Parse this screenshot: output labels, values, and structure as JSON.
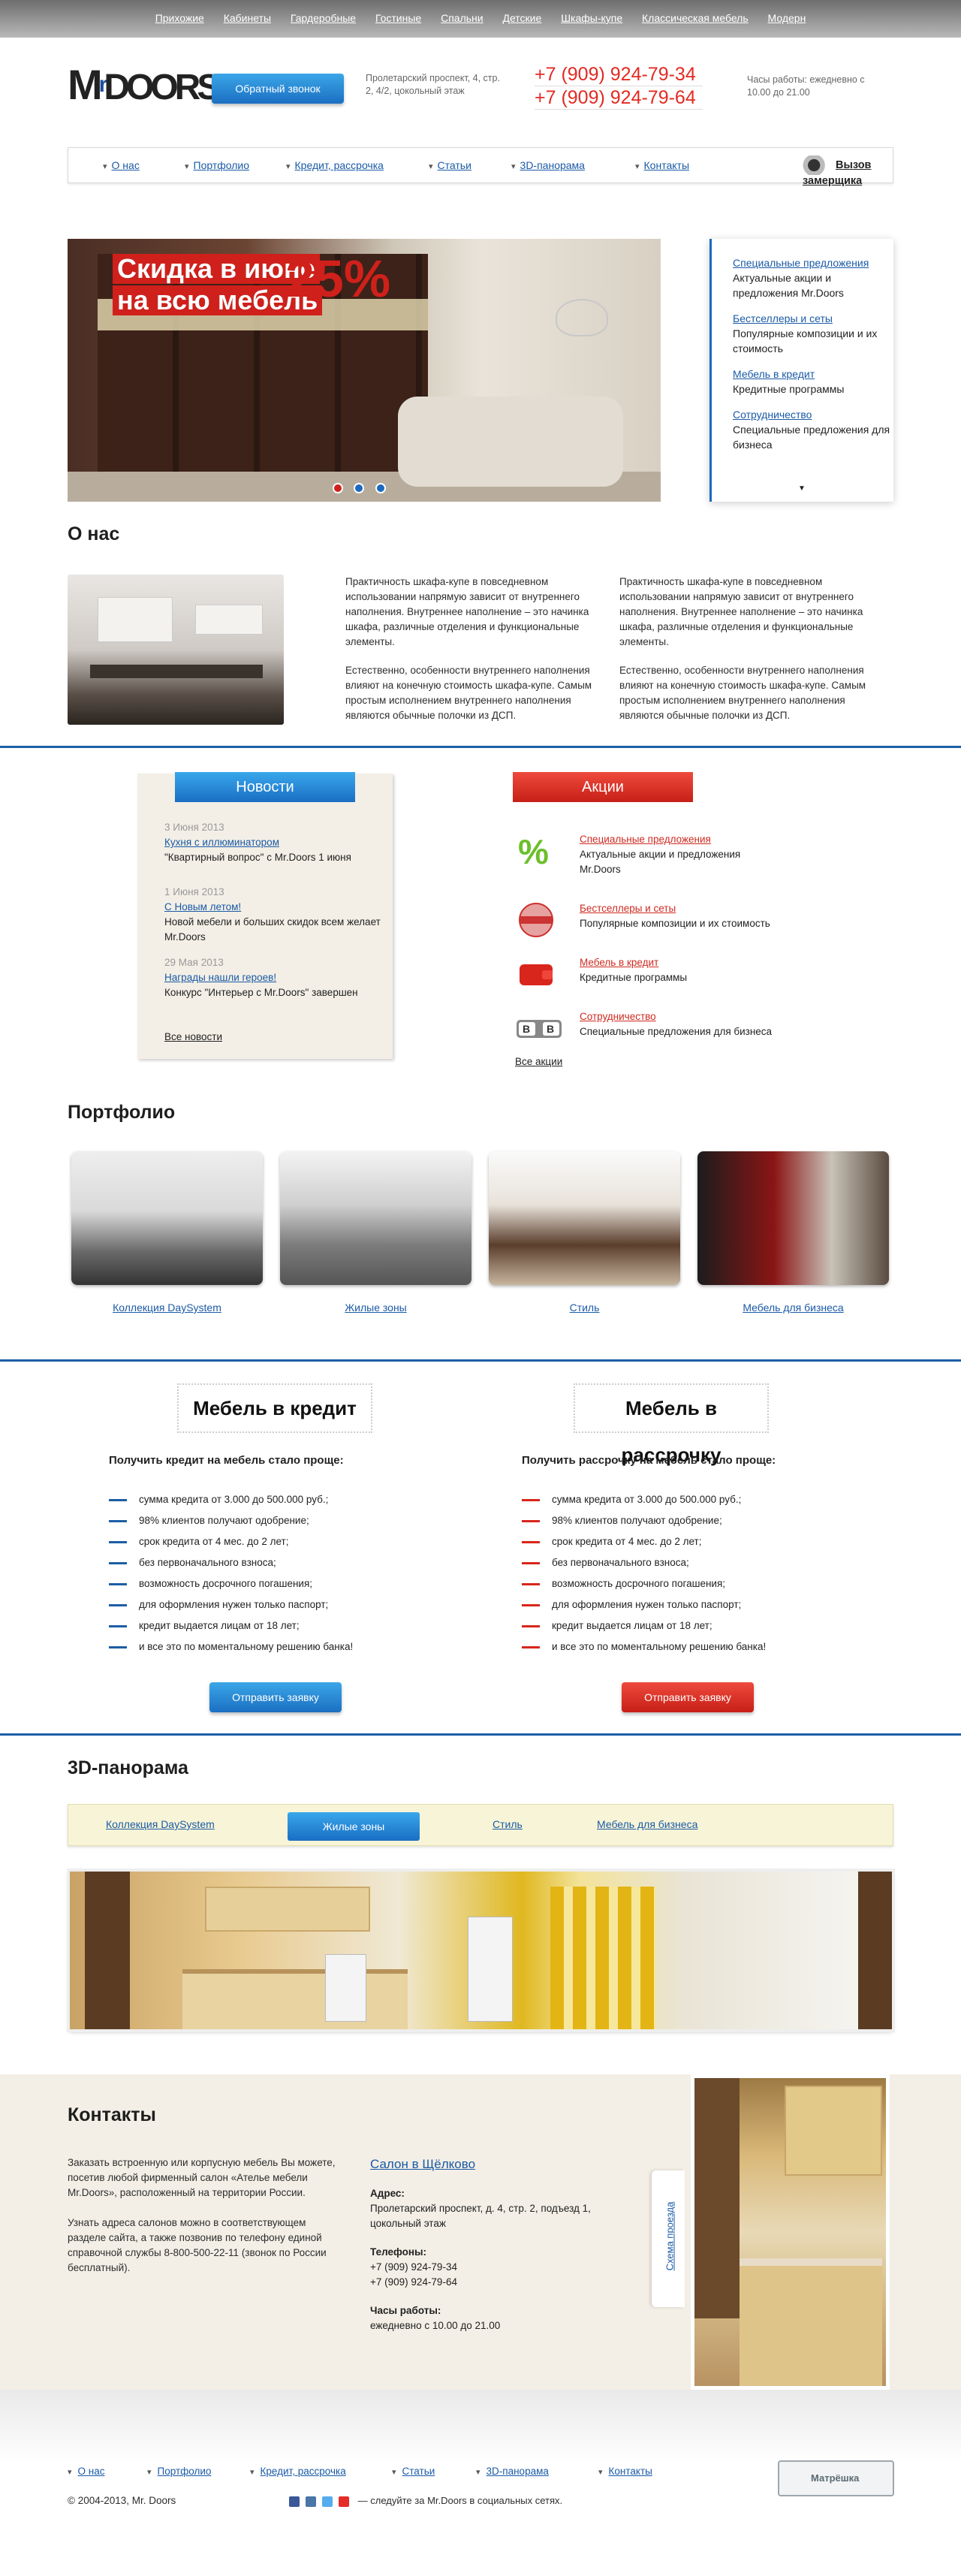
{
  "topnav": [
    "Прихожие",
    "Кабинеты",
    "Гардеробные",
    "Гостиные",
    "Спальни",
    "Детские",
    "Шкафы-купе",
    "Классическая мебель",
    "Модерн"
  ],
  "logo": {
    "text1": "M",
    "text2": "r",
    "text3": "DOORS",
    "alt": "Mr.Doors"
  },
  "header": {
    "callback_label": "Обратный звонок",
    "address": "Пролетарский проспект, 4, стр. 2, 4/2, цокольный этаж",
    "phone1": "+7 (909) 924-79-34",
    "phone2": "+7 (909) 924-79-64",
    "hours": "Часы работы: ежедневно с 10.00 до 21.00"
  },
  "mainnav": {
    "items": [
      "О нас",
      "Портфолио",
      "Кредит, рассрочка",
      "Статьи",
      "3D-панорама",
      "Контакты"
    ],
    "measure": "Вызов замерщика"
  },
  "banner": {
    "line1": "Скидка в июне",
    "line2": "на всю мебель",
    "percent": "25%",
    "dots": 3,
    "active_dot": 0,
    "colors": {
      "dot_active": "#d0201b",
      "dot": "#1c69c0"
    }
  },
  "sidebox": [
    {
      "link": "Специальные предложения",
      "text": "Актуальные акции и предложения Mr.Doors"
    },
    {
      "link": "Бестселлеры и сеты",
      "text": "Популярные композиции и их стоимость"
    },
    {
      "link": "Мебель в кредит",
      "text": "Кредитные программы"
    },
    {
      "link": "Сотрудничество",
      "text": "Специальные предложения для бизнеса"
    }
  ],
  "about": {
    "title": "О нас",
    "col1_p1": "Практичность шкафа-купе в повседневном использовании напрямую зависит от внутреннего наполнения. Внутреннее наполнение – это начинка шкафа, различные отделения и функциональные элементы.",
    "col1_p2": "Естественно, особенности внутреннего наполнения влияют на конечную стоимость шкафа-купе. Самым простым исполнением внутреннего наполнения являются обычные полочки из ДСП.",
    "col2_p1": "Практичность шкафа-купе в повседневном использовании напрямую зависит от внутреннего наполнения. Внутреннее наполнение – это начинка шкафа, различные отделения и функциональные элементы.",
    "col2_p2": "Естественно, особенности внутреннего наполнения влияют на конечную стоимость шкафа-купе. Самым простым исполнением внутреннего наполнения являются обычные полочки из ДСП."
  },
  "news": {
    "title": "Новости",
    "items": [
      {
        "date": "3 Июня 2013",
        "link": "Кухня с иллюминатором",
        "text": "\"Квартирный вопрос\" с Mr.Doors 1 июня"
      },
      {
        "date": "1 Июня 2013",
        "link": "С Новым летом!",
        "text": "Новой мебели и больших скидок всем желает Mr.Doors"
      },
      {
        "date": "29 Мая 2013",
        "link": "Награды нашли героев!",
        "text": "Конкурс \"Интерьер с Mr.Doors\" завершен"
      }
    ],
    "all": "Все новости"
  },
  "promos": {
    "title": "Акции",
    "items": [
      {
        "link": "Специальные предложения",
        "text": "Актуальные акции и предложения Mr.Doors",
        "icon": "percent-icon"
      },
      {
        "link": "Бестселлеры и сеты",
        "text": "Популярные композиции и их стоимость",
        "icon": "bestseller-stamp-icon"
      },
      {
        "link": "Мебель в кредит",
        "text": "Кредитные программы",
        "icon": "wallet-icon"
      },
      {
        "link": "Сотрудничество",
        "text": "Специальные предложения для бизнеса",
        "icon": "b2b-icon"
      }
    ],
    "all": "Все акции"
  },
  "portfolio": {
    "title": "Портфолио",
    "items": [
      "Коллекция DaySystem",
      "Жилые зоны",
      "Стиль",
      "Мебель для бизнеса"
    ]
  },
  "credit": {
    "left_title": "Мебель в кредит",
    "left_heading": "Получить кредит на мебель стало проще:",
    "right_title": "Мебель в рассрочку",
    "right_heading": "Получить рассрочку на мебель стало проще:",
    "items": [
      "сумма кредита от 3.000 до 500.000 руб.;",
      "98% клиентов получают одобрение;",
      "срок кредита от 4 мес. до 2 лет;",
      "без первоначального взноса;",
      "возможность досрочного погашения;",
      "для оформления нужен только паспорт;",
      "кредит выдается лицам от 18 лет;",
      "и все это по моментальному решению банка!"
    ],
    "button": "Отправить заявку"
  },
  "panorama": {
    "title": "3D-панорама",
    "tabs": [
      "Коллекция DaySystem",
      "Жилые зоны",
      "Стиль",
      "Мебель для бизнеса"
    ],
    "active": "Жилые зоны"
  },
  "contacts": {
    "title": "Контакты",
    "p1": "Заказать встроенную или корпусную мебель Вы можете, посетив любой фирменный салон «Ателье мебели Mr.Doors», расположенный на территории России.",
    "p2": "Узнать адреса салонов можно в соответствующем разделе сайта, а также позвонив по телефону единой справочной службы 8-800-500-22-11 (звонок по России бесплатный).",
    "salon": "Салон в Щёлково",
    "addr_label": "Адрес:",
    "addr": "Пролетарский проспект, д. 4, стр. 2, подъезд 1, цокольный этаж",
    "tel_label": "Телефоны:",
    "tel1": "+7 (909) 924-79-34",
    "tel2": "+7 (909) 924-79-64",
    "hours_label": "Часы работы:",
    "hours": "ежедневно с 10.00 до 21.00",
    "scheme": "Схема проезда"
  },
  "footer": {
    "nav": [
      "О нас",
      "Портфолио",
      "Кредит, рассрочка",
      "Статьи",
      "3D-панорама",
      "Контакты"
    ],
    "copyright": "© 2004-2013, Mr. Doors",
    "social_text": "— следуйте за Mr.Doors в социальных сетях.",
    "partner": "Матрёшка"
  }
}
